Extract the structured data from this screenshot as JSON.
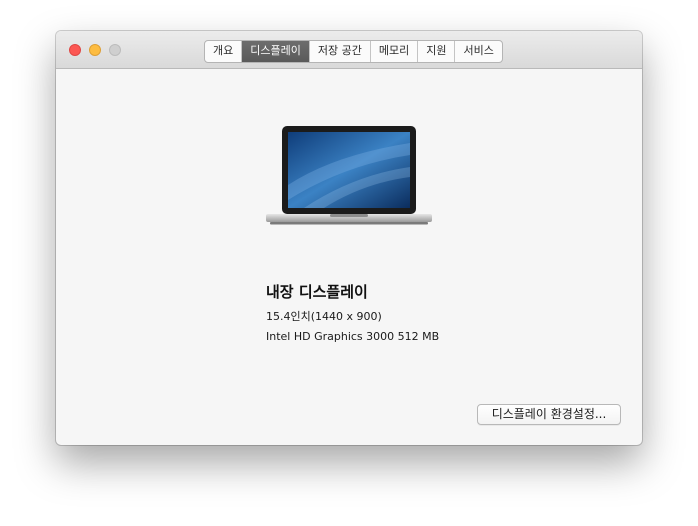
{
  "tabs": [
    {
      "label": "개요",
      "active": false
    },
    {
      "label": "디스플레이",
      "active": true
    },
    {
      "label": "저장 공간",
      "active": false
    },
    {
      "label": "메모리",
      "active": false
    },
    {
      "label": "지원",
      "active": false
    },
    {
      "label": "서비스",
      "active": false
    }
  ],
  "display": {
    "title": "내장 디스플레이",
    "size": "15.4인치(1440 x 900)",
    "graphics": "Intel HD Graphics 3000 512 MB"
  },
  "buttons": {
    "prefs_label": "디스플레이 환경설정..."
  },
  "colors": {
    "close": "#fc5753",
    "minimize": "#fdbc40",
    "zoom_inactive": "#cfcfcf",
    "active_tab": "#5f5f5f"
  },
  "icons": {
    "device": "macbook-pro-icon"
  }
}
